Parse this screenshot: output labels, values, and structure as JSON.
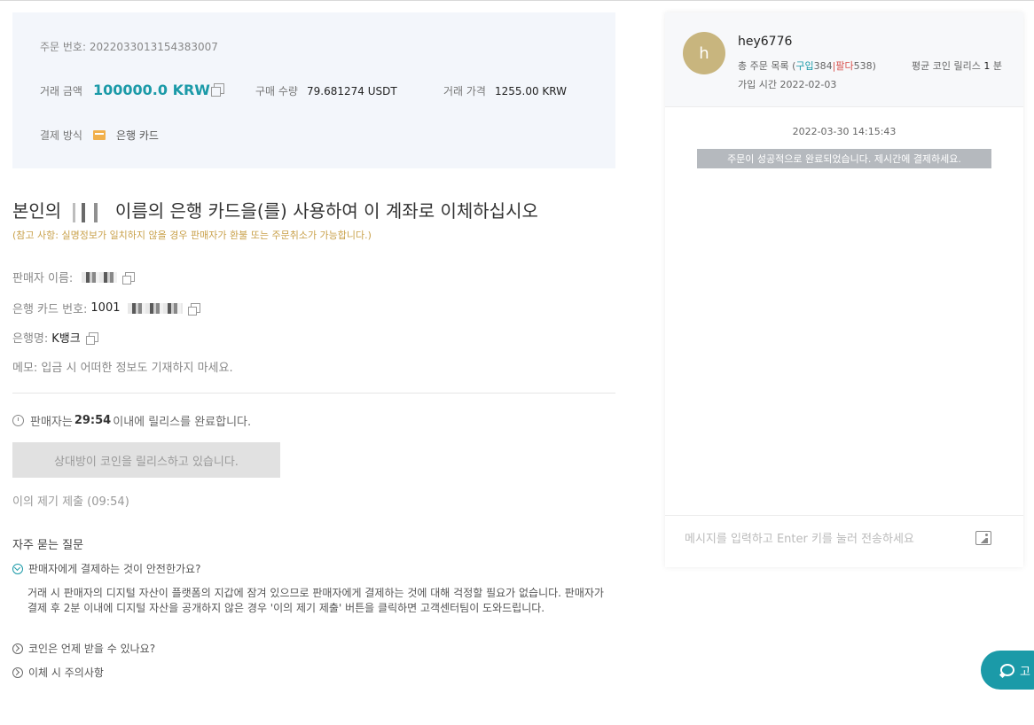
{
  "order": {
    "number_label": "주문 번호:",
    "number": "2022033013154383007",
    "amount_label": "거래 금액",
    "amount": "100000.0 KRW",
    "qty_label": "구매 수량",
    "qty": "79.681274 USDT",
    "price_label": "거래 가격",
    "price": "1255.00 KRW",
    "pay_label": "결제 방식",
    "pay_method": "은행 카드"
  },
  "instruction": {
    "prefix": "본인의",
    "suffix": "이름의 은행 카드을(를) 사용하여 이 계좌로 이체하십시오",
    "note": "(참고 사항: 실명정보가 일치하지 않을 경우 판매자가 환불 또는 주문취소가 가능합니다.)"
  },
  "seller": {
    "name_label": "판매자 이름:",
    "card_label": "은행 카드 번호:",
    "card_prefix": "1001",
    "bank_label": "은행명:",
    "bank": "K뱅크",
    "memo": "메모: 입금 시 어떠한 정보도 기재하지 마세요."
  },
  "release": {
    "prefix": "판매자는",
    "time": "29:54",
    "suffix": "이내에 릴리스를 완료합니다.",
    "button": "상대방이 코인을 릴리스하고 있습니다.",
    "dispute": "이의 제기 제출 (09:54)"
  },
  "faq": {
    "title": "자주 묻는 질문",
    "q1": "판매자에게 결제하는 것이 안전한가요?",
    "a1": "거래 시 판매자의 디지털 자산이 플랫폼의 지갑에 잠겨 있으므로 판매자에게 결제하는 것에 대해 걱정할 필요가 없습니다. 판매자가 결제 후 2분 이내에 디지털 자산을 공개하지 않은 경우 '이의 제기 제출' 버튼을 클릭하면 고객센터팀이 도와드립니다.",
    "q2": "코인은 언제 받을 수 있나요?",
    "q3": "이체 시 주의사항"
  },
  "chat": {
    "avatar_letter": "h",
    "username": "hey6776",
    "orders_label": "총 주문 목록 (",
    "buy_label": "구입",
    "buy_count": "384",
    "sep": "|",
    "sell_label": "팔다",
    "sell_count": "538",
    "close": ")",
    "avg_label": "평균 코인 릴리스",
    "avg_value": "1",
    "avg_unit": "분",
    "joined": "가입 시간 2022-02-03",
    "time": "2022-03-30 14:15:43",
    "system_msg": "주문이 성공적으로 완료되었습니다. 제시간에 결제하세요.",
    "input_placeholder": "메시지를 입력하고 Enter 키를 눌러 전송하세요"
  },
  "help": {
    "label": "고"
  },
  "colors": {
    "accent": "#1b9aa8",
    "sell": "#d9534f",
    "note": "#c9a14b"
  }
}
